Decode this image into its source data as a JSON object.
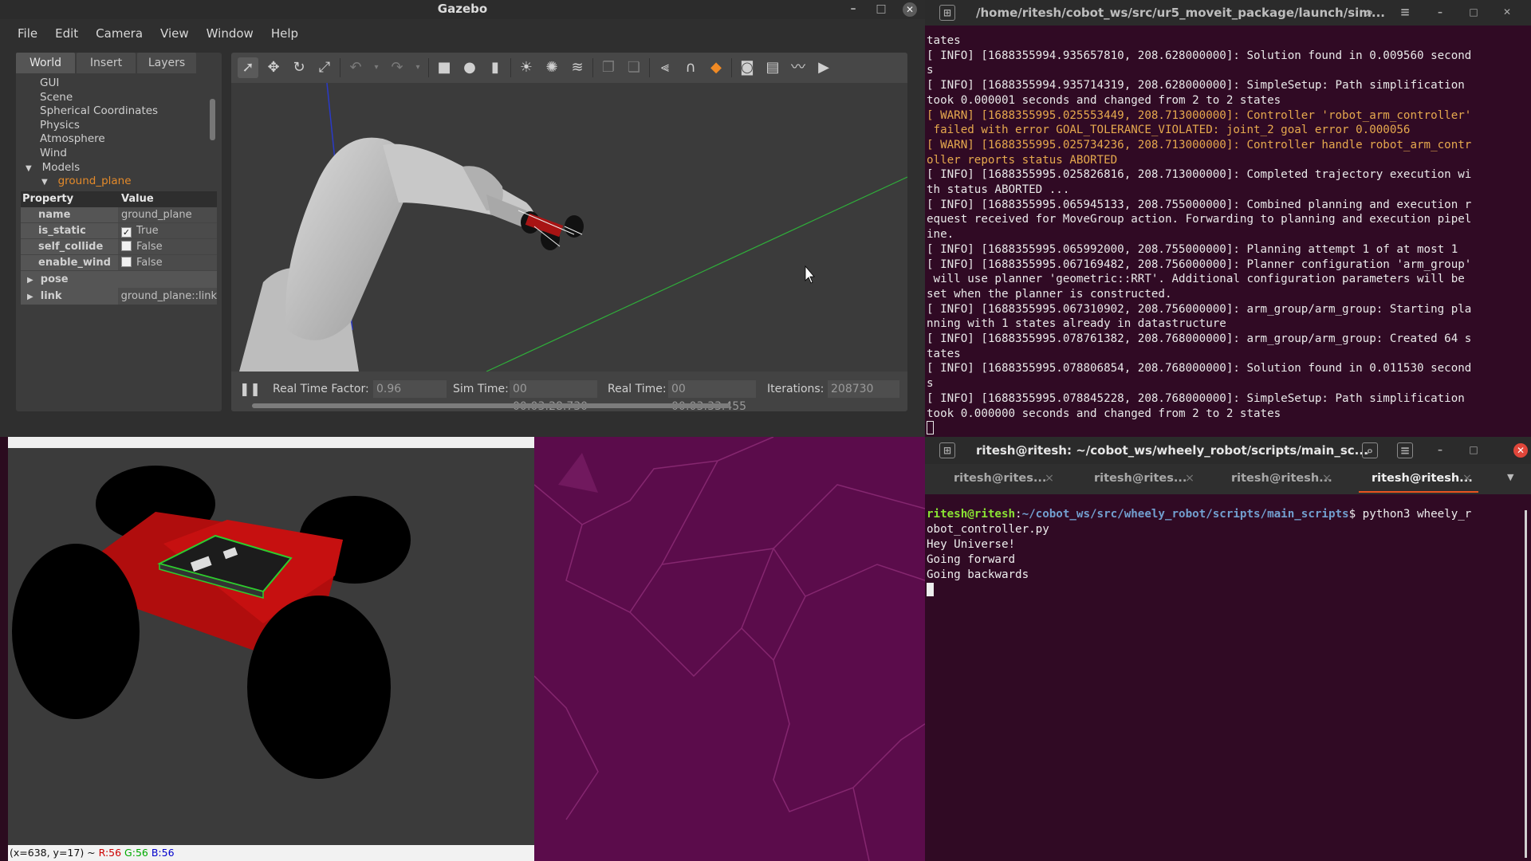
{
  "gazebo": {
    "window_title": "Gazebo",
    "menu": [
      "File",
      "Edit",
      "Camera",
      "View",
      "Window",
      "Help"
    ],
    "tabs": [
      "World",
      "Insert",
      "Layers"
    ],
    "tree": {
      "items": [
        "GUI",
        "Scene",
        "Spherical Coordinates",
        "Physics",
        "Atmosphere",
        "Wind"
      ],
      "models_label": "Models",
      "selected_model": "ground_plane"
    },
    "properties": {
      "header_property": "Property",
      "header_value": "Value",
      "rows": [
        {
          "key": "name",
          "value": "ground_plane"
        },
        {
          "key": "is_static",
          "value": "True",
          "checked": true
        },
        {
          "key": "self_collide",
          "value": "False",
          "checked": false
        },
        {
          "key": "enable_wind",
          "value": "False",
          "checked": false
        }
      ],
      "pose_label": "pose",
      "link_label": "link",
      "link_value": "ground_plane::link"
    },
    "status": {
      "rtf_label": "Real Time Factor:",
      "rtf_value": "0.96",
      "sim_label": "Sim Time:",
      "sim_value": "00 00:03:28.730",
      "real_label": "Real Time:",
      "real_value": "00 00:03:33.455",
      "iter_label": "Iterations:",
      "iter_value": "208730"
    }
  },
  "terminal_top": {
    "title": "/home/ritesh/cobot_ws/src/ur5_moveit_package/launch/sim...",
    "lines": [
      {
        "t": "tates",
        "warn": false
      },
      {
        "t": "[ INFO] [1688355994.935657810, 208.628000000]: Solution found in 0.009560 second",
        "warn": false
      },
      {
        "t": "s",
        "warn": false
      },
      {
        "t": "[ INFO] [1688355994.935714319, 208.628000000]: SimpleSetup: Path simplification",
        "warn": false
      },
      {
        "t": "took 0.000001 seconds and changed from 2 to 2 states",
        "warn": false
      },
      {
        "t": "[ WARN] [1688355995.025553449, 208.713000000]: Controller 'robot_arm_controller'",
        "warn": true
      },
      {
        "t": " failed with error GOAL_TOLERANCE_VIOLATED: joint_2 goal error 0.000056",
        "warn": true
      },
      {
        "t": "[ WARN] [1688355995.025734236, 208.713000000]: Controller handle robot_arm_contr",
        "warn": true
      },
      {
        "t": "oller reports status ABORTED",
        "warn": true
      },
      {
        "t": "[ INFO] [1688355995.025826816, 208.713000000]: Completed trajectory execution wi",
        "warn": false
      },
      {
        "t": "th status ABORTED ...",
        "warn": false
      },
      {
        "t": "[ INFO] [1688355995.065945133, 208.755000000]: Combined planning and execution r",
        "warn": false
      },
      {
        "t": "equest received for MoveGroup action. Forwarding to planning and execution pipel",
        "warn": false
      },
      {
        "t": "ine.",
        "warn": false
      },
      {
        "t": "[ INFO] [1688355995.065992000, 208.755000000]: Planning attempt 1 of at most 1",
        "warn": false
      },
      {
        "t": "[ INFO] [1688355995.067169482, 208.756000000]: Planner configuration 'arm_group'",
        "warn": false
      },
      {
        "t": " will use planner 'geometric::RRT'. Additional configuration parameters will be",
        "warn": false
      },
      {
        "t": "set when the planner is constructed.",
        "warn": false
      },
      {
        "t": "[ INFO] [1688355995.067310902, 208.756000000]: arm_group/arm_group: Starting pla",
        "warn": false
      },
      {
        "t": "nning with 1 states already in datastructure",
        "warn": false
      },
      {
        "t": "[ INFO] [1688355995.078761382, 208.768000000]: arm_group/arm_group: Created 64 s",
        "warn": false
      },
      {
        "t": "tates",
        "warn": false
      },
      {
        "t": "[ INFO] [1688355995.078806854, 208.768000000]: Solution found in 0.011530 second",
        "warn": false
      },
      {
        "t": "s",
        "warn": false
      },
      {
        "t": "[ INFO] [1688355995.078845228, 208.768000000]: SimpleSetup: Path simplification",
        "warn": false
      },
      {
        "t": "took 0.000000 seconds and changed from 2 to 2 states",
        "warn": false
      }
    ]
  },
  "image_viewer": {
    "status_prefix": "(x=638, y=17) ~",
    "r": "R:56",
    "g": "G:56",
    "b": "B:56"
  },
  "terminal_bottom": {
    "title": "ritesh@ritesh: ~/cobot_ws/wheely_robot/scripts/main_sc...",
    "tabs": [
      "ritesh@rites...",
      "ritesh@rites...",
      "ritesh@ritesh...",
      "ritesh@ritesh..."
    ],
    "prompt_user": "ritesh@ritesh",
    "prompt_path": "~/cobot_ws/src/wheely_robot/scripts/main_scripts",
    "command_1": "$ python3 wheely_r",
    "command_2": "obot_controller.py",
    "output": [
      "Hey Universe!",
      "Going forward",
      "Going backwards"
    ]
  },
  "colors": {
    "terminal_bg": "#300a24",
    "warn": "#e6a94e",
    "accent": "#e95420",
    "selected_model": "#e48a2a"
  }
}
